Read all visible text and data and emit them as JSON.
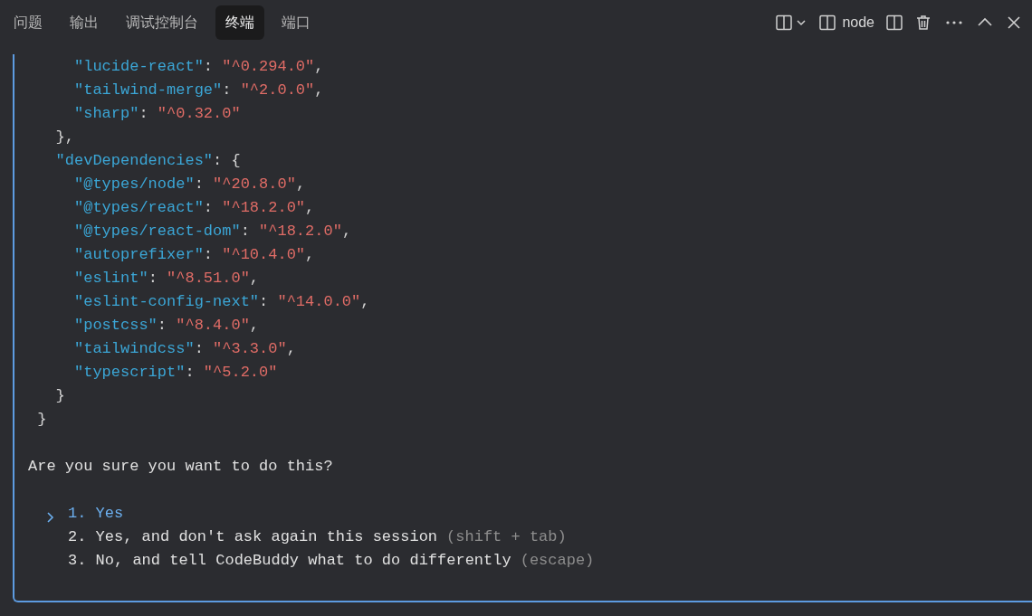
{
  "tabs": [
    {
      "label": "问题",
      "selected": false
    },
    {
      "label": "输出",
      "selected": false
    },
    {
      "label": "调试控制台",
      "selected": false
    },
    {
      "label": "终端",
      "selected": true
    },
    {
      "label": "端口",
      "selected": false
    }
  ],
  "toolbar": {
    "terminal_name": "node"
  },
  "terminal": {
    "lines": [
      {
        "segments": [
          {
            "kind": "key",
            "text": "     \"lucide-react\""
          },
          {
            "kind": "punct",
            "text": ": "
          },
          {
            "kind": "string",
            "text": "\"^0.294.0\""
          },
          {
            "kind": "punct",
            "text": ","
          }
        ]
      },
      {
        "segments": [
          {
            "kind": "key",
            "text": "     \"tailwind-merge\""
          },
          {
            "kind": "punct",
            "text": ": "
          },
          {
            "kind": "string",
            "text": "\"^2.0.0\""
          },
          {
            "kind": "punct",
            "text": ","
          }
        ]
      },
      {
        "segments": [
          {
            "kind": "key",
            "text": "     \"sharp\""
          },
          {
            "kind": "punct",
            "text": ": "
          },
          {
            "kind": "string",
            "text": "\"^0.32.0\""
          }
        ]
      },
      {
        "segments": [
          {
            "kind": "punct",
            "text": "   },"
          }
        ]
      },
      {
        "segments": [
          {
            "kind": "key",
            "text": "   \"devDependencies\""
          },
          {
            "kind": "punct",
            "text": ": {"
          }
        ]
      },
      {
        "segments": [
          {
            "kind": "key",
            "text": "     \"@types/node\""
          },
          {
            "kind": "punct",
            "text": ": "
          },
          {
            "kind": "string",
            "text": "\"^20.8.0\""
          },
          {
            "kind": "punct",
            "text": ","
          }
        ]
      },
      {
        "segments": [
          {
            "kind": "key",
            "text": "     \"@types/react\""
          },
          {
            "kind": "punct",
            "text": ": "
          },
          {
            "kind": "string",
            "text": "\"^18.2.0\""
          },
          {
            "kind": "punct",
            "text": ","
          }
        ]
      },
      {
        "segments": [
          {
            "kind": "key",
            "text": "     \"@types/react-dom\""
          },
          {
            "kind": "punct",
            "text": ": "
          },
          {
            "kind": "string",
            "text": "\"^18.2.0\""
          },
          {
            "kind": "punct",
            "text": ","
          }
        ]
      },
      {
        "segments": [
          {
            "kind": "key",
            "text": "     \"autoprefixer\""
          },
          {
            "kind": "punct",
            "text": ": "
          },
          {
            "kind": "string",
            "text": "\"^10.4.0\""
          },
          {
            "kind": "punct",
            "text": ","
          }
        ]
      },
      {
        "segments": [
          {
            "kind": "key",
            "text": "     \"eslint\""
          },
          {
            "kind": "punct",
            "text": ": "
          },
          {
            "kind": "string",
            "text": "\"^8.51.0\""
          },
          {
            "kind": "punct",
            "text": ","
          }
        ]
      },
      {
        "segments": [
          {
            "kind": "key",
            "text": "     \"eslint-config-next\""
          },
          {
            "kind": "punct",
            "text": ": "
          },
          {
            "kind": "string",
            "text": "\"^14.0.0\""
          },
          {
            "kind": "punct",
            "text": ","
          }
        ]
      },
      {
        "segments": [
          {
            "kind": "key",
            "text": "     \"postcss\""
          },
          {
            "kind": "punct",
            "text": ": "
          },
          {
            "kind": "string",
            "text": "\"^8.4.0\""
          },
          {
            "kind": "punct",
            "text": ","
          }
        ]
      },
      {
        "segments": [
          {
            "kind": "key",
            "text": "     \"tailwindcss\""
          },
          {
            "kind": "punct",
            "text": ": "
          },
          {
            "kind": "string",
            "text": "\"^3.3.0\""
          },
          {
            "kind": "punct",
            "text": ","
          }
        ]
      },
      {
        "segments": [
          {
            "kind": "key",
            "text": "     \"typescript\""
          },
          {
            "kind": "punct",
            "text": ": "
          },
          {
            "kind": "string",
            "text": "\"^5.2.0\""
          }
        ]
      },
      {
        "segments": [
          {
            "kind": "punct",
            "text": "   }"
          }
        ]
      },
      {
        "segments": [
          {
            "kind": "punct",
            "text": " }"
          }
        ]
      }
    ],
    "question": "Are you sure you want to do this?",
    "options": [
      {
        "label": "1. Yes",
        "selected": true
      },
      {
        "label": "2. Yes, and don't ask again this session",
        "hint": "(shift + tab)",
        "selected": false
      },
      {
        "label": "3. No, and tell CodeBuddy what to do differently",
        "hint": "(escape)",
        "selected": false
      }
    ]
  }
}
